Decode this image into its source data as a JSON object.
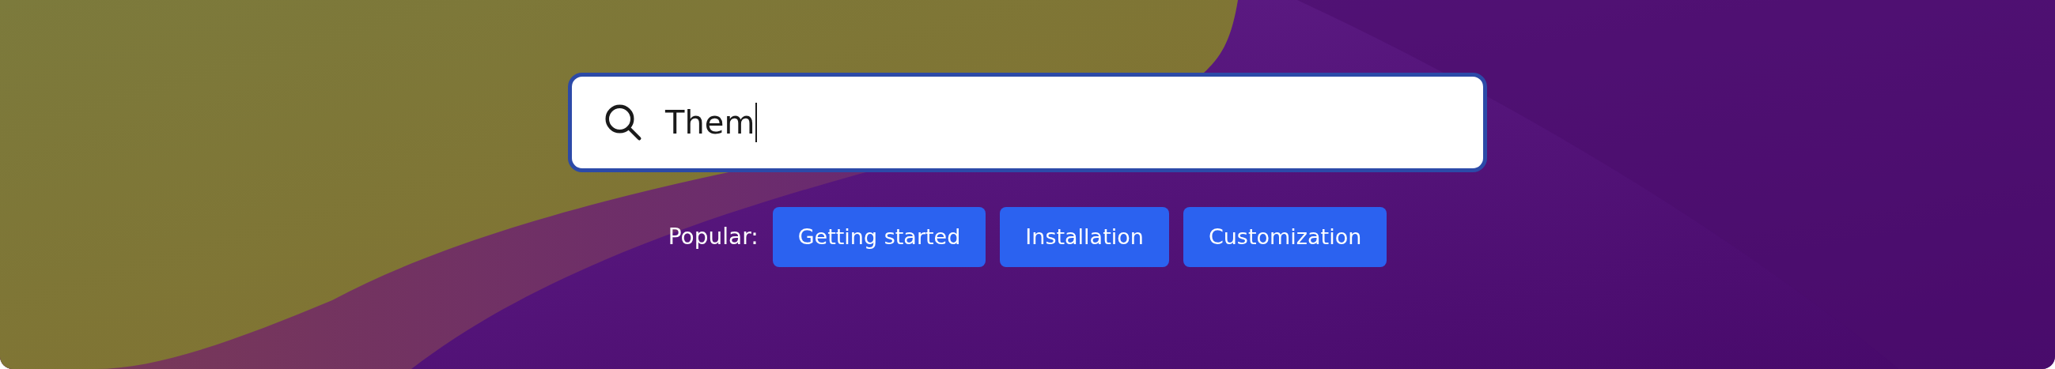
{
  "search": {
    "value": "Them"
  },
  "popular": {
    "label": "Popular:",
    "tags": [
      {
        "label": "Getting started"
      },
      {
        "label": "Installation"
      },
      {
        "label": "Customization"
      }
    ]
  }
}
